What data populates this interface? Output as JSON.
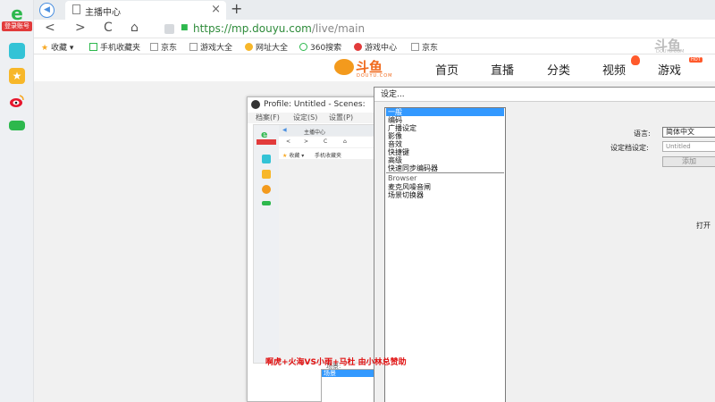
{
  "sidebar": {
    "logo_letter": "e",
    "login_label": "登录账号",
    "icons": [
      "teal-app-icon",
      "star-icon",
      "weibo-icon",
      "green-app-icon"
    ]
  },
  "browser": {
    "tab_title": "主播中心",
    "tab_close": "×",
    "new_tab": "+",
    "back": "<",
    "forward": ">",
    "reload": "C",
    "home": "⌂",
    "url_scheme": "https://",
    "url_host": "mp.douyu.com",
    "url_path": "/live/main"
  },
  "bookmarks": [
    {
      "label": "收藏",
      "icon": "star-icon"
    },
    {
      "label": "手机收藏夹",
      "icon": "phone-icon"
    },
    {
      "label": "京东",
      "icon": "page-icon"
    },
    {
      "label": "游戏大全",
      "icon": "page-icon"
    },
    {
      "label": "网址大全",
      "icon": "globe-icon"
    },
    {
      "label": "360搜索",
      "icon": "search-icon"
    },
    {
      "label": "游戏中心",
      "icon": "game-icon"
    },
    {
      "label": "京东",
      "icon": "page-icon"
    }
  ],
  "site": {
    "logo_text": "斗鱼",
    "logo_sub": "DOUYU.COM",
    "nav": [
      "首页",
      "直播",
      "分类",
      "视频",
      "游戏"
    ],
    "hot_badge": "HOT",
    "watermark": "斗鱼",
    "watermark_sub": "DOUYU.COM"
  },
  "obs": {
    "title": "Profile: Untitled - Scenes: ",
    "menu": [
      "档案(F)",
      "设定(S)",
      "设置(P)"
    ],
    "preview_tab": "主播中心",
    "preview_bm1": "收藏",
    "preview_bm2": "手机收藏夹",
    "scene_label": "场景:",
    "scene_selected": "场景"
  },
  "settings": {
    "title": "设定...",
    "categories": [
      "一般",
      "编码",
      "广播设定",
      "影像",
      "音效",
      "快捷键",
      "高级",
      "快速同步编码器"
    ],
    "group_label": "Browser",
    "plugins": [
      "麦克风噪音闸",
      "场景切换器"
    ],
    "language_label": "语言:",
    "language_value": "简体中文",
    "profile_label": "设定档设定:",
    "profile_value": "Untitled",
    "add_button": "添加",
    "open_label": "打开"
  },
  "overlay": {
    "sponsor_text": "啊虎+火海VS小雨+马杜 由小林总赞助"
  },
  "colors": {
    "selection": "#3399ff",
    "url_green": "#2e8b3a",
    "douyu_orange": "#f06a1d",
    "sponsor_red": "#e01010"
  }
}
